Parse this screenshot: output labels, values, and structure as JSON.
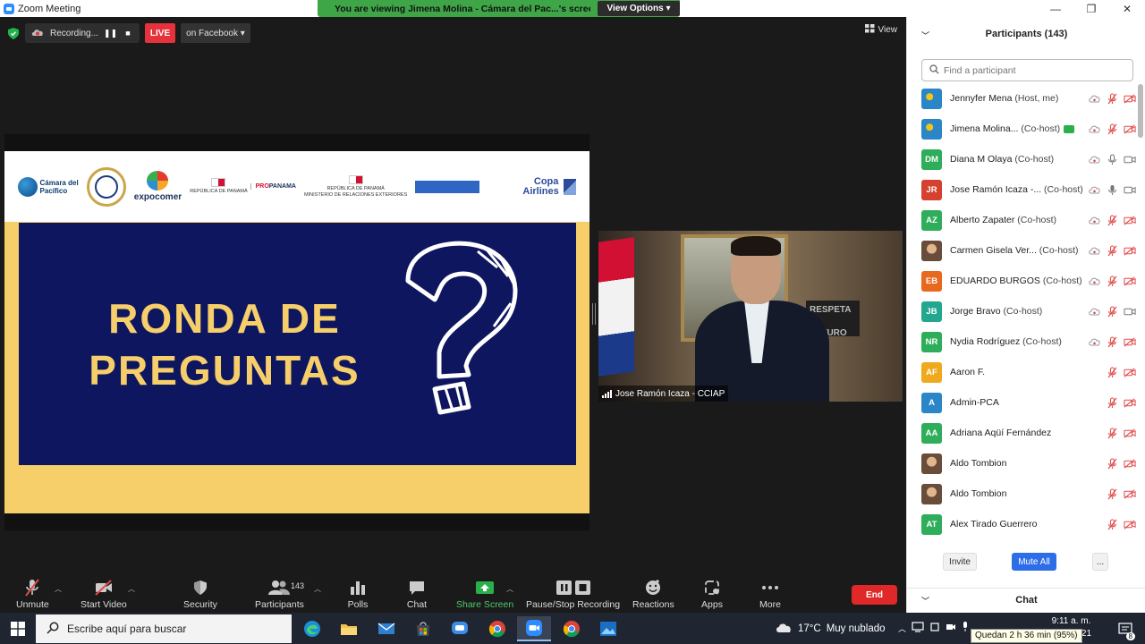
{
  "window": {
    "title": "Zoom Meeting"
  },
  "banner": {
    "viewing_text": "You are viewing Jimena Molina - Cámara del Pac...'s screen",
    "view_options_label": "View Options ▾"
  },
  "topbar": {
    "recording_label": "Recording...",
    "live_label": "LIVE",
    "live_destination": "on Facebook ▾",
    "view_label": "View"
  },
  "slide": {
    "title_line1": "RONDA DE",
    "title_line2": "PREGUNTAS",
    "logos": {
      "camara_line1": "Cámara del",
      "camara_line2": "Pacífico",
      "expocomer": "expocomer",
      "panama_small": "REPÚBLICA DE PANAMÁ",
      "propanama_pro": "PRO",
      "propanama_rest": "PANAMA",
      "ministerio_line1": "REPÚBLICA DE PANAMÁ",
      "ministerio_line2": "MINISTERIO DE RELACIONES EXTERIORES",
      "copa": "Copa Airlines"
    }
  },
  "speaker": {
    "name": "Jose Ramón Icaza - CCIAP",
    "plaque": "RESPETA EL FUTURO"
  },
  "toolbar": {
    "unmute": "Unmute",
    "start_video": "Start Video",
    "security": "Security",
    "participants": "Participants",
    "participants_count": "143",
    "polls": "Polls",
    "chat": "Chat",
    "share_screen": "Share Screen",
    "pause_stop_recording": "Pause/Stop Recording",
    "reactions": "Reactions",
    "apps": "Apps",
    "more": "More",
    "end": "End"
  },
  "panel": {
    "title": "Participants (143)",
    "search_placeholder": "Find a participant",
    "participants": [
      {
        "name": "Jennyfer Mena",
        "role": "(Host, me)",
        "avatar": "",
        "avatar_type": "globe",
        "color": "#2b86c8",
        "mic": "muted",
        "video": "off"
      },
      {
        "name": "Jimena Molina...",
        "role": "(Co-host)",
        "avatar": "",
        "avatar_type": "globe",
        "color": "#2b86c8",
        "mic": "muted",
        "video": "off",
        "sharing": true
      },
      {
        "name": "Diana M Olaya",
        "role": "(Co-host)",
        "avatar": "DM",
        "avatar_type": "initials",
        "color": "#2eae5a",
        "mic": "on",
        "video": "on"
      },
      {
        "name": "Jose Ramón Icaza -...",
        "role": "(Co-host)",
        "avatar": "JR",
        "avatar_type": "initials",
        "color": "#d6402e",
        "mic": "active",
        "video": "on"
      },
      {
        "name": "Alberto Zapater",
        "role": "(Co-host)",
        "avatar": "AZ",
        "avatar_type": "initials",
        "color": "#2eae5a",
        "mic": "muted",
        "video": "off"
      },
      {
        "name": "Carmen Gisela Ver...",
        "role": "(Co-host)",
        "avatar": "",
        "avatar_type": "photo",
        "color": "#8a5b3f",
        "mic": "muted",
        "video": "off"
      },
      {
        "name": "EDUARDO BURGOS",
        "role": "(Co-host)",
        "avatar": "EB",
        "avatar_type": "initials",
        "color": "#e8681e",
        "mic": "muted",
        "video": "off"
      },
      {
        "name": "Jorge Bravo",
        "role": "(Co-host)",
        "avatar": "JB",
        "avatar_type": "initials",
        "color": "#23a88f",
        "mic": "muted",
        "video": "on"
      },
      {
        "name": "Nydia Rodríguez",
        "role": "(Co-host)",
        "avatar": "NR",
        "avatar_type": "initials",
        "color": "#2eae5a",
        "mic": "muted",
        "video": "off"
      },
      {
        "name": "Aaron F.",
        "role": "",
        "avatar": "AF",
        "avatar_type": "initials",
        "color": "#f0a91c",
        "mic": "muted",
        "video": "off"
      },
      {
        "name": "Admin-PCA",
        "role": "",
        "avatar": "A",
        "avatar_type": "initials",
        "color": "#2b86c8",
        "mic": "muted",
        "video": "off"
      },
      {
        "name": "Adriana Aqüí Fernández",
        "role": "",
        "avatar": "AA",
        "avatar_type": "initials",
        "color": "#2eae5a",
        "mic": "muted",
        "video": "off"
      },
      {
        "name": "Aldo Tombion",
        "role": "",
        "avatar": "",
        "avatar_type": "photo",
        "color": "#6a4c3a",
        "mic": "muted",
        "video": "off"
      },
      {
        "name": "Aldo Tombion",
        "role": "",
        "avatar": "",
        "avatar_type": "photo",
        "color": "#6a4c3a",
        "mic": "muted",
        "video": "off"
      },
      {
        "name": "Alex Tirado Guerrero",
        "role": "",
        "avatar": "AT",
        "avatar_type": "initials",
        "color": "#2eae5a",
        "mic": "muted",
        "video": "off"
      }
    ],
    "invite_label": "Invite",
    "mute_all_label": "Mute All",
    "more_label": "...",
    "chat_label": "Chat"
  },
  "taskbar": {
    "search_placeholder": "Escribe aquí para buscar",
    "weather_temp": "17°C",
    "weather_text": "Muy nublado",
    "time": "9:11 a. m.",
    "date_fragment": "/2021",
    "battery_tooltip": "Quedan 2 h 36 min (95%)",
    "notification_count": "8"
  },
  "colors": {
    "zoom_blue": "#2d8cff",
    "banner_green": "#3fa648",
    "live_red": "#e5323b",
    "slide_navy": "#0f1660",
    "slide_gold": "#f6cf6a",
    "end_red": "#e02828",
    "muted_red": "#e04a4a"
  }
}
